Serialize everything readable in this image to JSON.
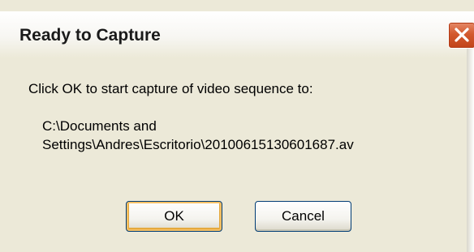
{
  "window": {
    "title": "Ready to Capture"
  },
  "body": {
    "message": "Click OK to start capture of video sequence to:",
    "path_line1": "C:\\Documents and",
    "path_line2": "Settings\\Andres\\Escritorio\\20100615130601687.av"
  },
  "buttons": {
    "ok_label": "OK",
    "cancel_label": "Cancel"
  },
  "icons": {
    "close": "close-icon"
  },
  "colors": {
    "dialog_bg": "#ece9d8",
    "close_button": "#c2441a",
    "button_border": "#003c74",
    "default_focus": "#f5c065"
  }
}
